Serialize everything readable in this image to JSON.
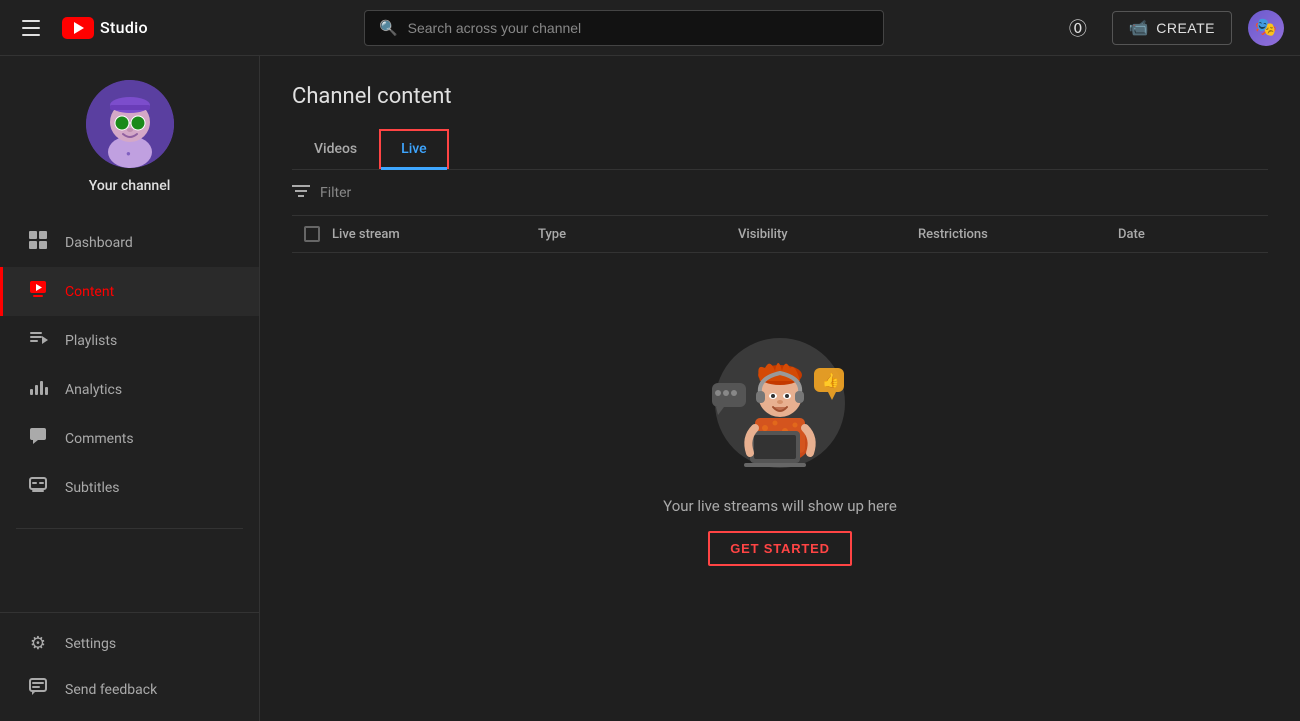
{
  "header": {
    "menu_icon": "☰",
    "logo_text": "Studio",
    "search_placeholder": "Search across your channel",
    "help_icon": "?",
    "create_label": "CREATE",
    "create_icon": "🎥",
    "avatar_emoji": "👤"
  },
  "sidebar": {
    "channel_name": "Your channel",
    "channel_emoji": "🎭",
    "nav_items": [
      {
        "id": "dashboard",
        "label": "Dashboard",
        "icon": "⊞",
        "active": false
      },
      {
        "id": "content",
        "label": "Content",
        "icon": "▶",
        "active": true
      },
      {
        "id": "playlists",
        "label": "Playlists",
        "icon": "≡",
        "active": false
      },
      {
        "id": "analytics",
        "label": "Analytics",
        "icon": "📊",
        "active": false
      },
      {
        "id": "comments",
        "label": "Comments",
        "icon": "💬",
        "active": false
      },
      {
        "id": "subtitles",
        "label": "Subtitles",
        "icon": "⊟",
        "active": false
      }
    ],
    "bottom_items": [
      {
        "id": "settings",
        "label": "Settings",
        "icon": "⚙"
      },
      {
        "id": "send-feedback",
        "label": "Send feedback",
        "icon": "✉"
      }
    ]
  },
  "content": {
    "page_title": "Channel content",
    "tabs": [
      {
        "id": "videos",
        "label": "Videos",
        "active": false
      },
      {
        "id": "live",
        "label": "Live",
        "active": true
      }
    ],
    "filter_label": "Filter",
    "table_columns": {
      "live_stream": "Live stream",
      "type": "Type",
      "visibility": "Visibility",
      "restrictions": "Restrictions",
      "date": "Date"
    },
    "empty_state": {
      "message": "Your live streams will show up here",
      "button_label": "GET STARTED"
    }
  }
}
